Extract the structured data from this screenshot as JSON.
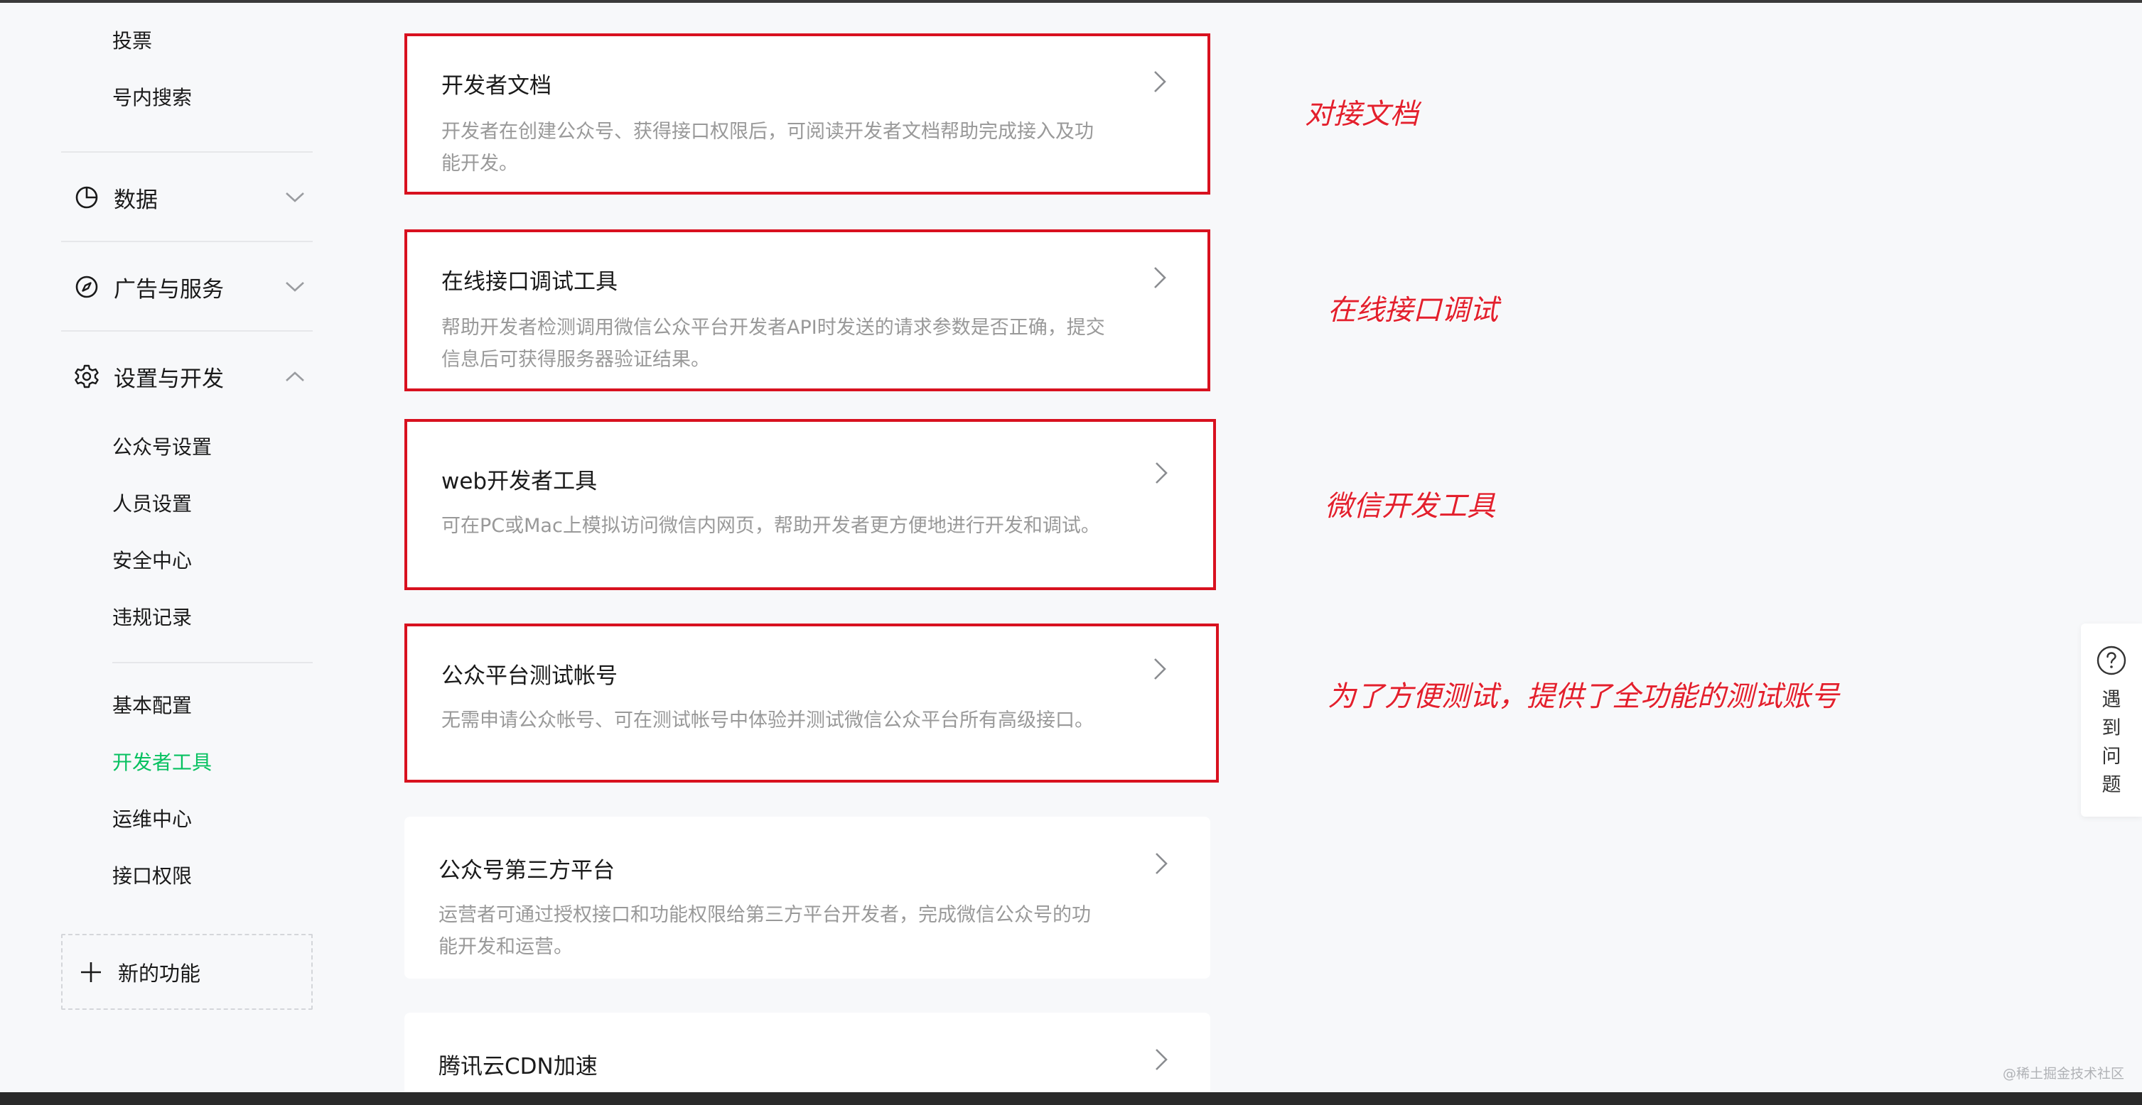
{
  "sidebar": {
    "top_items": [
      "投票",
      "号内搜索"
    ],
    "groups": {
      "data": {
        "label": "数据",
        "icon": "pie-chart-icon",
        "expanded": false
      },
      "ads": {
        "label": "广告与服务",
        "icon": "compass-icon",
        "expanded": false
      },
      "settings": {
        "label": "设置与开发",
        "icon": "gear-icon",
        "expanded": true
      }
    },
    "settings_items": [
      "公众号设置",
      "人员设置",
      "安全中心",
      "违规记录"
    ],
    "dev_items": [
      "基本配置",
      "开发者工具",
      "运维中心",
      "接口权限"
    ],
    "active_item": "开发者工具",
    "new_feature_label": "新的功能"
  },
  "cards": [
    {
      "title": "开发者文档",
      "desc": "开发者在创建公众号、获得接口权限后，可阅读开发者文档帮助完成接入及功能开发。",
      "highlighted": true
    },
    {
      "title": "在线接口调试工具",
      "desc": "帮助开发者检测调用微信公众平台开发者API时发送的请求参数是否正确，提交信息后可获得服务器验证结果。",
      "highlighted": true
    },
    {
      "title": "web开发者工具",
      "desc": "可在PC或Mac上模拟访问微信内网页，帮助开发者更方便地进行开发和调试。",
      "highlighted": true
    },
    {
      "title": "公众平台测试帐号",
      "desc": "无需申请公众帐号、可在测试帐号中体验并测试微信公众平台所有高级接口。",
      "highlighted": true
    },
    {
      "title": "公众号第三方平台",
      "desc": "运营者可通过授权接口和功能权限给第三方平台开发者，完成微信公众号的功能开发和运营。",
      "highlighted": false
    },
    {
      "title": "腾讯云CDN加速",
      "desc": "",
      "highlighted": false
    }
  ],
  "annotations": [
    "对接文档",
    "在线接口调试",
    "微信开发工具",
    "为了方便测试，提供了全功能的测试账号"
  ],
  "help": {
    "label": "遇到问题",
    "icon": "question-circle-icon"
  },
  "watermark": "@稀土掘金技术社区",
  "colors": {
    "accent": "#07c160",
    "highlight_border": "#d8111f",
    "annotation": "#e3202d"
  }
}
